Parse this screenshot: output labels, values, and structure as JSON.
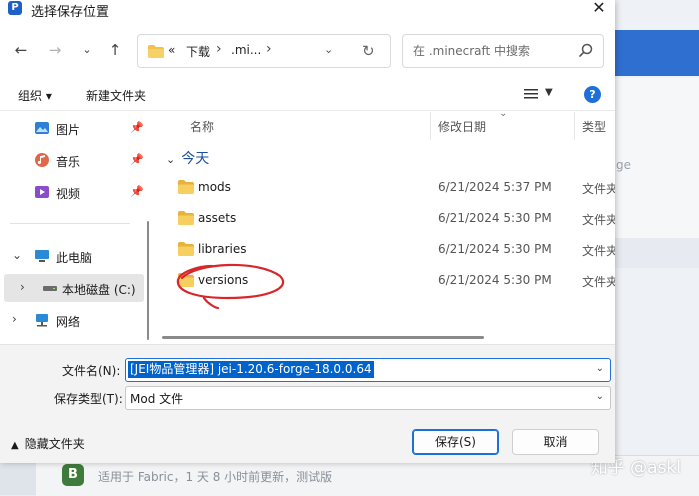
{
  "window": {
    "title": "选择保存位置",
    "app_icon_letter": "P"
  },
  "nav": {
    "breadcrumb": [
      "«",
      "下载",
      ".mi..."
    ],
    "search_placeholder": "在 .minecraft 中搜索"
  },
  "command_bar": {
    "organize_label": "组织 ▾",
    "new_folder_label": "新建文件夹",
    "help_label": "?"
  },
  "sidebar": {
    "items": [
      {
        "label": "图片",
        "icon": "pictures-icon"
      },
      {
        "label": "音乐",
        "icon": "music-icon"
      },
      {
        "label": "视频",
        "icon": "video-icon"
      },
      {
        "label": "此电脑",
        "icon": "computer-icon"
      },
      {
        "label": "本地磁盘 (C:)",
        "icon": "drive-icon"
      },
      {
        "label": "网络",
        "icon": "network-icon"
      }
    ]
  },
  "file_list": {
    "columns": {
      "name": "名称",
      "date": "修改日期",
      "type": "类型"
    },
    "group_label": "今天",
    "rows": [
      {
        "name": "mods",
        "date": "6/21/2024 5:37 PM",
        "type": "文件夹"
      },
      {
        "name": "assets",
        "date": "6/21/2024 5:30 PM",
        "type": "文件夹"
      },
      {
        "name": "libraries",
        "date": "6/21/2024 5:30 PM",
        "type": "文件夹"
      },
      {
        "name": "versions",
        "date": "6/21/2024 5:30 PM",
        "type": "文件夹"
      }
    ]
  },
  "save_form": {
    "filename_label": "文件名(N):",
    "filename_value": "[JEI物品管理器] jei-1.20.6-forge-18.0.0.64",
    "filetype_label": "保存类型(T):",
    "filetype_value": "Mod 文件",
    "hide_folders_label": "隐藏文件夹",
    "save_label": "保存(S)",
    "cancel_label": "取消"
  },
  "background": {
    "side_text": "ge",
    "row_description": "适用于 Fabric，1 天 8 小时前更新，测试版",
    "row_logo_letter": "B",
    "watermark": "知乎 @askl"
  },
  "colors": {
    "accent": "#1e6fd9",
    "selection": "#0063cc",
    "folder": "#f2c14e",
    "annotation": "#d8262b"
  }
}
